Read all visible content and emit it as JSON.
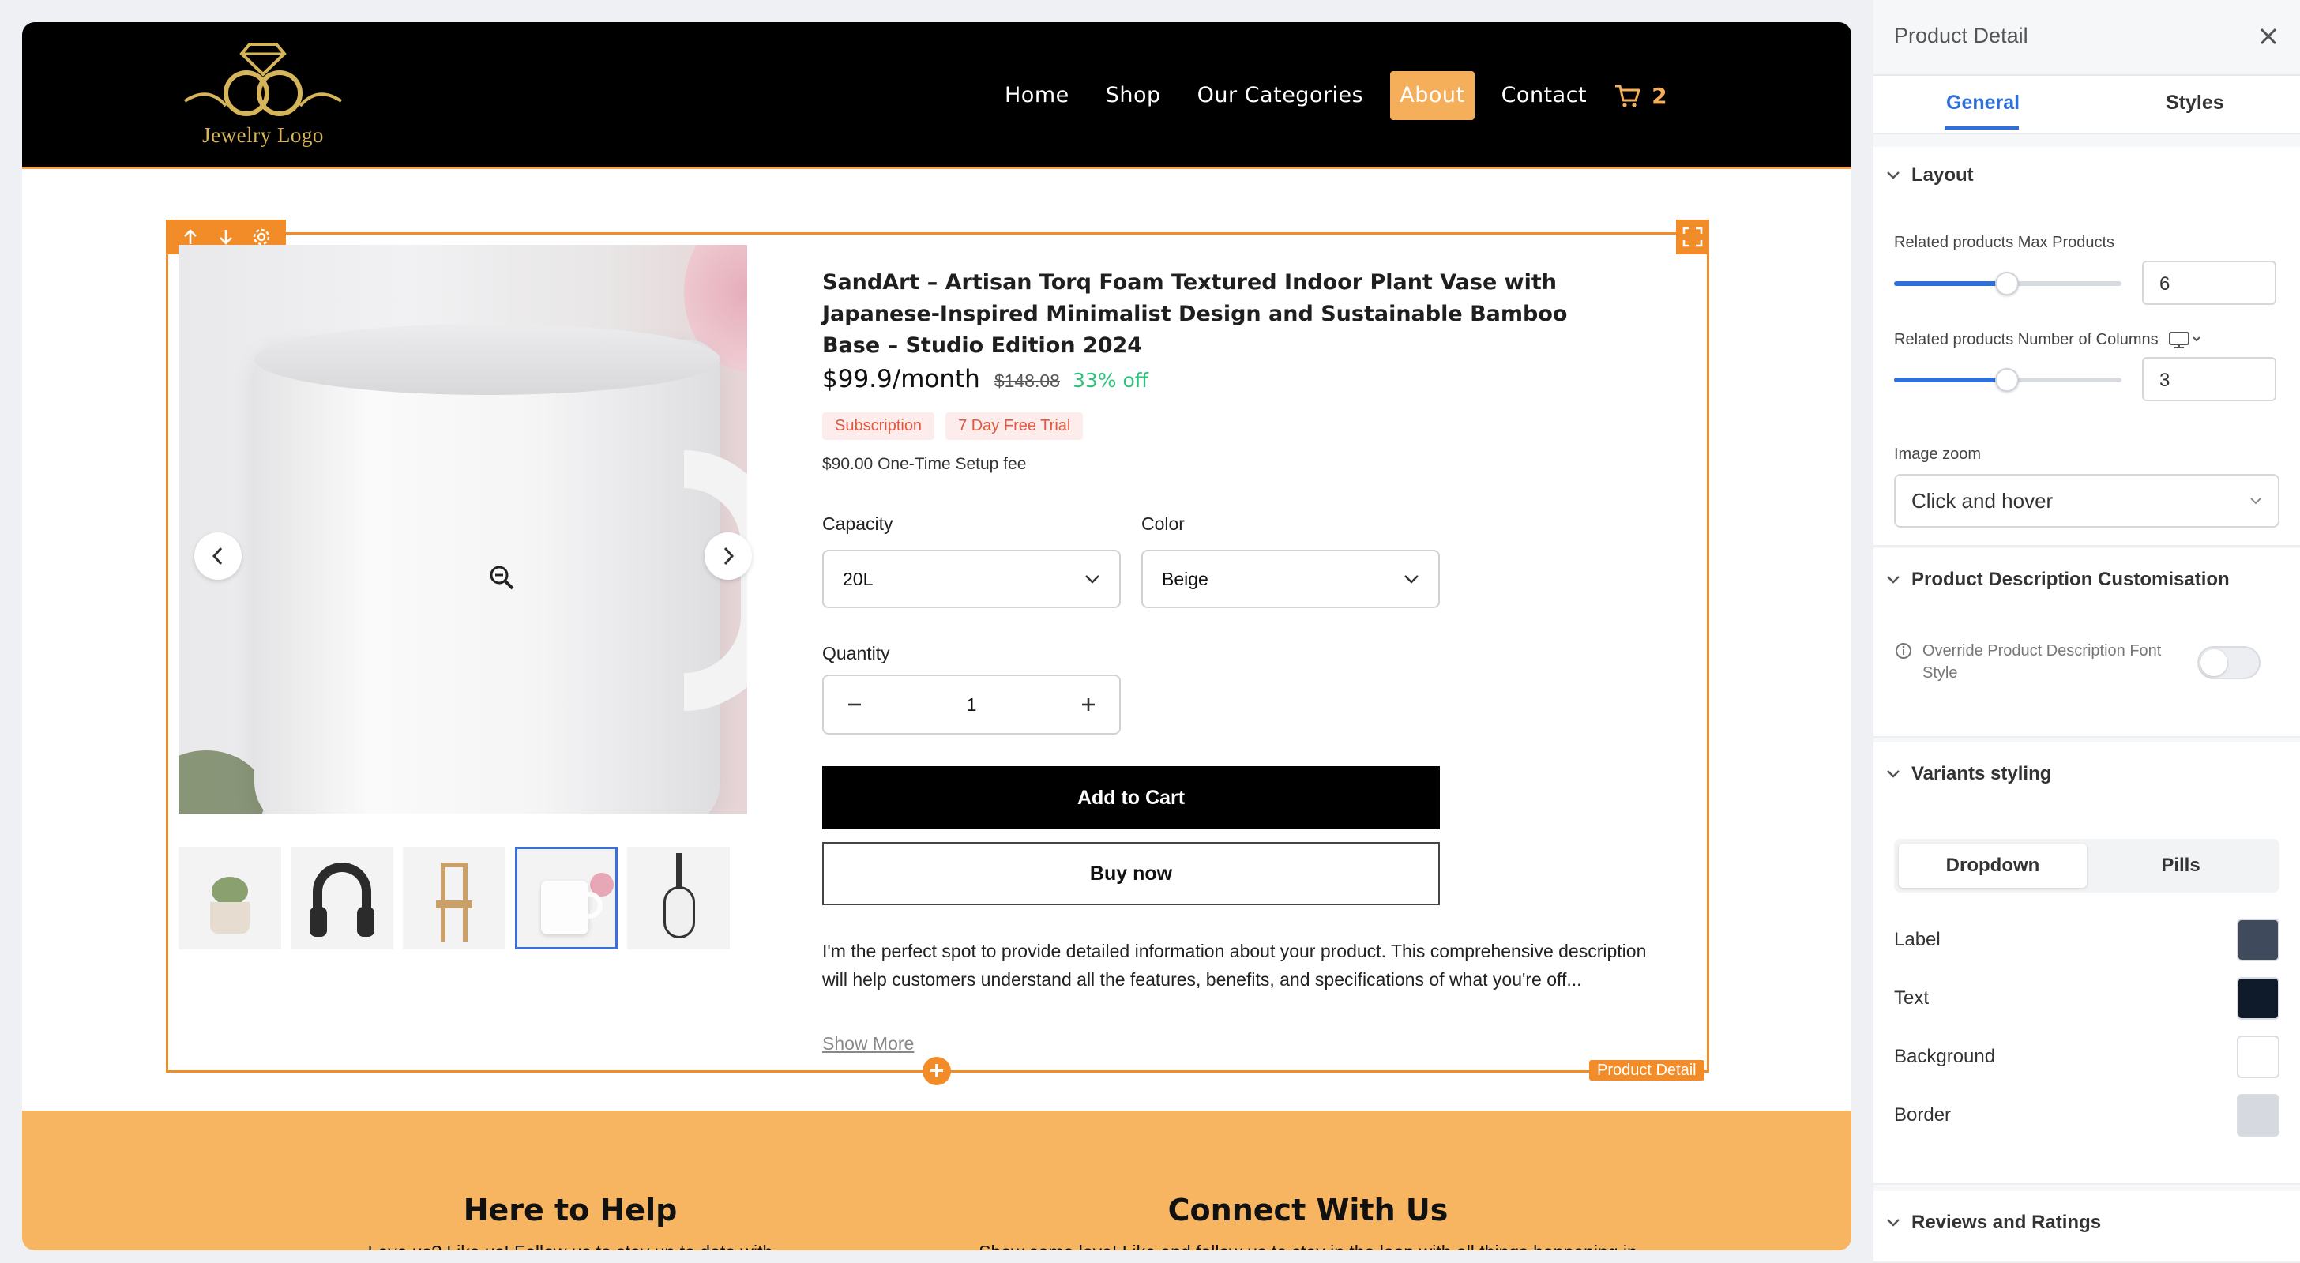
{
  "site": {
    "logo_text": "Jewelry Logo",
    "nav": [
      "Home",
      "Shop",
      "Our Categories",
      "About",
      "Contact"
    ],
    "cart_count": "2",
    "accent_color": "#f5ae5a"
  },
  "editor": {
    "block_label": "Product Detail"
  },
  "product": {
    "title": "SandArt – Artisan Torq Foam Textured Indoor Plant Vase with Japanese-Inspired Minimalist Design and Sustainable Bamboo Base – Studio Edition 2024",
    "price": "$99.9/month",
    "old_price": "$148.08",
    "discount": "33% off",
    "badges": [
      "Subscription",
      "7 Day Free Trial"
    ],
    "setup_fee": "$90.00 One-Time Setup fee",
    "capacity_label": "Capacity",
    "capacity_value": "20L",
    "color_label": "Color",
    "color_value": "Beige",
    "quantity_label": "Quantity",
    "quantity_value": "1",
    "add_to_cart": "Add to Cart",
    "buy_now": "Buy now",
    "description": "I'm the perfect spot to provide detailed information about your product. This comprehensive description will help customers understand all the features, benefits, and specifications of what you're off...",
    "show_more": "Show More"
  },
  "footer": {
    "col1_title": "Here to Help",
    "col1_text": "Love us? Like us! Follow us to stay up to date with",
    "col2_title": "Connect With Us",
    "col2_text": "Show some love! Like and follow us to stay in the loop with all things happening in"
  },
  "panel": {
    "title": "Product Detail",
    "tabs": [
      "General",
      "Styles"
    ],
    "layout_section": "Layout",
    "max_products_label": "Related products Max Products",
    "max_products_value": "6",
    "columns_label": "Related products Number of Columns",
    "columns_value": "3",
    "image_zoom_label": "Image zoom",
    "image_zoom_value": "Click and hover",
    "desc_section": "Product Description Customisation",
    "override_label": "Override Product Description Font Style",
    "variants_section": "Variants styling",
    "variant_modes": [
      "Dropdown",
      "Pills"
    ],
    "color_rows": [
      {
        "label": "Label",
        "color": "#3f4a5c"
      },
      {
        "label": "Text",
        "color": "#0f1a2b"
      },
      {
        "label": "Background",
        "color": "#ffffff"
      },
      {
        "label": "Border",
        "color": "#d6dae0"
      }
    ],
    "reviews_section": "Reviews and Ratings",
    "active_color": "#2f6fd8"
  }
}
